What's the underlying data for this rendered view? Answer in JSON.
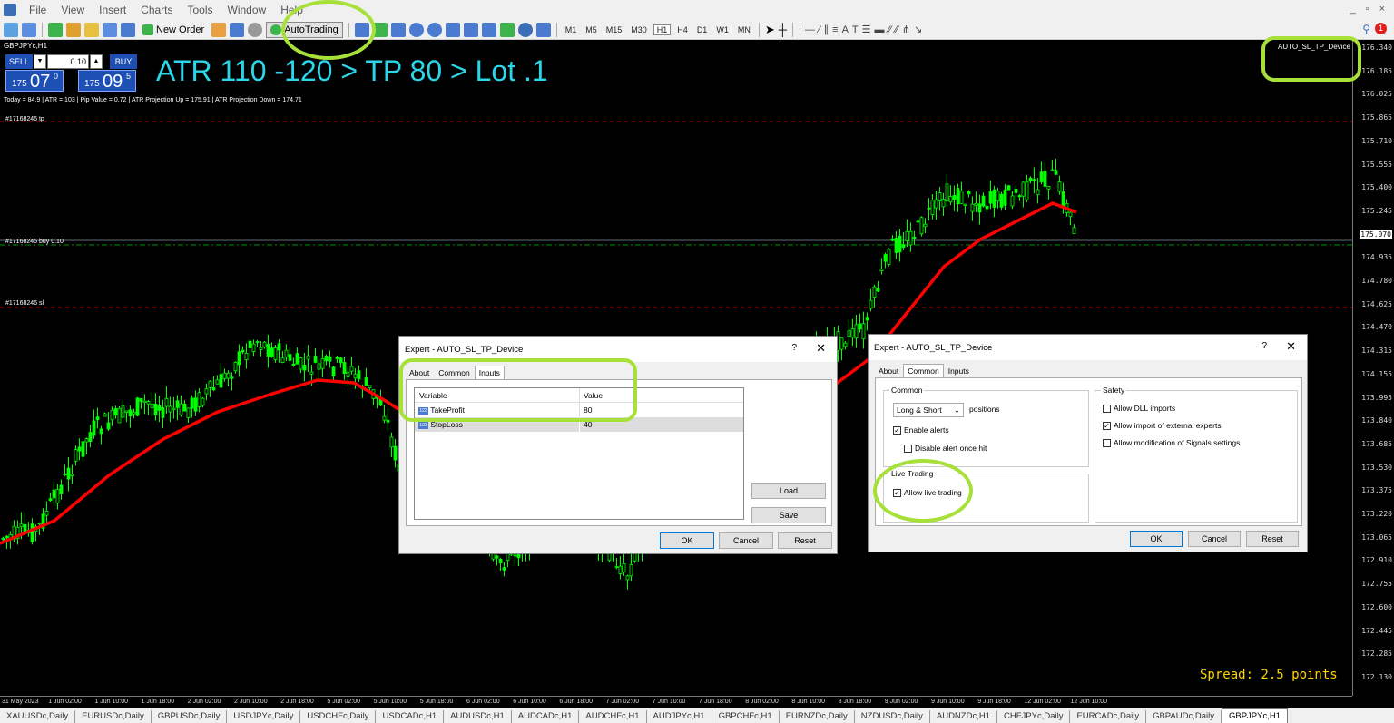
{
  "menu": {
    "items": [
      "File",
      "View",
      "Insert",
      "Charts",
      "Tools",
      "Window",
      "Help"
    ],
    "window_controls": "_ ▫ ×"
  },
  "toolbar": {
    "new_order_label": "New Order",
    "autotrading_label": "AutoTrading",
    "timeframes": [
      "M1",
      "M5",
      "M15",
      "M30",
      "H1",
      "H4",
      "D1",
      "W1",
      "MN"
    ],
    "active_timeframe": "H1"
  },
  "chart": {
    "symbol_title": "GBPJPYc,H1",
    "trade_panel": {
      "sell_label": "SELL",
      "buy_label": "BUY",
      "lot": "0.10",
      "sell_price_small": "175",
      "sell_price_big": "07",
      "sell_price_sup": "0",
      "buy_price_small": "175",
      "buy_price_big": "09",
      "buy_price_sup": "5"
    },
    "headline": "ATR 110 -120 > TP 80 > Lot .1",
    "info_line": "Today = 84.9  |  ATR = 103  |  Pip Value = 0.72  |  ATR Projection Up = 175.91  |  ATR Projection Down = 174.71",
    "order_labels": {
      "tp": "#17168246 tp",
      "buy": "#17168246 buy 0.10",
      "sl": "#17168246 sl"
    },
    "ea_label": "AUTO_SL_TP_Device ☺",
    "spread_text": "Spread: 2.5 points",
    "price_labels": [
      "176.340",
      "176.185",
      "176.025",
      "175.865",
      "175.710",
      "175.555",
      "175.400",
      "175.245",
      "175.070",
      "174.935",
      "174.780",
      "174.625",
      "174.470",
      "174.315",
      "174.155",
      "173.995",
      "173.840",
      "173.685",
      "173.530",
      "173.375",
      "173.220",
      "173.065",
      "172.910",
      "172.755",
      "172.600",
      "172.445",
      "172.285",
      "172.130"
    ],
    "current_price": "175.070",
    "time_labels": [
      "31 May 2023",
      "1 Jun 02:00",
      "1 Jun 10:00",
      "1 Jun 18:00",
      "2 Jun 02:00",
      "2 Jun 10:00",
      "2 Jun 18:00",
      "5 Jun 02:00",
      "5 Jun 10:00",
      "5 Jun 18:00",
      "6 Jun 02:00",
      "6 Jun 10:00",
      "6 Jun 18:00",
      "7 Jun 02:00",
      "7 Jun 10:00",
      "7 Jun 18:00",
      "8 Jun 02:00",
      "8 Jun 10:00",
      "8 Jun 18:00",
      "9 Jun 02:00",
      "9 Jun 10:00",
      "9 Jun 18:00",
      "12 Jun 02:00",
      "12 Jun 10:00"
    ],
    "colors": {
      "candle": "#00ff00",
      "ma": "#ff0000",
      "tp_sl_line": "#ff0000",
      "entry_line": "#00c000",
      "headline": "#2bd6e8",
      "spread": "#ffd400"
    }
  },
  "dialog_inputs": {
    "title": "Expert - AUTO_SL_TP_Device",
    "help": "?",
    "close": "✕",
    "tabs": [
      "About",
      "Common",
      "Inputs"
    ],
    "active_tab": "Inputs",
    "columns": [
      "Variable",
      "Value"
    ],
    "rows": [
      {
        "icon": "123",
        "variable": "TakeProfit",
        "value": "80"
      },
      {
        "icon": "123",
        "variable": "StopLoss",
        "value": "40"
      }
    ],
    "load_label": "Load",
    "save_label": "Save",
    "ok_label": "OK",
    "cancel_label": "Cancel",
    "reset_label": "Reset"
  },
  "dialog_common": {
    "title": "Expert - AUTO_SL_TP_Device",
    "help": "?",
    "close": "✕",
    "tabs": [
      "About",
      "Common",
      "Inputs"
    ],
    "active_tab": "Common",
    "common_group": "Common",
    "positions_select": "Long & Short",
    "positions_label": "positions",
    "enable_alerts": "Enable alerts",
    "disable_alert_once": "Disable alert once hit",
    "live_group": "Live Trading",
    "allow_live": "Allow live trading",
    "safety_group": "Safety",
    "allow_dll": "Allow DLL imports",
    "allow_import": "Allow import of external experts",
    "allow_signals": "Allow modification of Signals settings",
    "ok_label": "OK",
    "cancel_label": "Cancel",
    "reset_label": "Reset"
  },
  "symbol_tabs": [
    "XAUUSDc,Daily",
    "EURUSDc,Daily",
    "GBPUSDc,Daily",
    "USDJPYc,Daily",
    "USDCHFc,Daily",
    "USDCADc,H1",
    "AUDUSDc,H1",
    "AUDCADc,H1",
    "AUDCHFc,H1",
    "AUDJPYc,H1",
    "GBPCHFc,H1",
    "EURNZDc,Daily",
    "NZDUSDc,Daily",
    "AUDNZDc,H1",
    "CHFJPYc,Daily",
    "EURCADc,Daily",
    "GBPAUDc,Daily",
    "GBPJPYc,H1"
  ],
  "active_symbol_tab": "GBPJPYc,H1"
}
